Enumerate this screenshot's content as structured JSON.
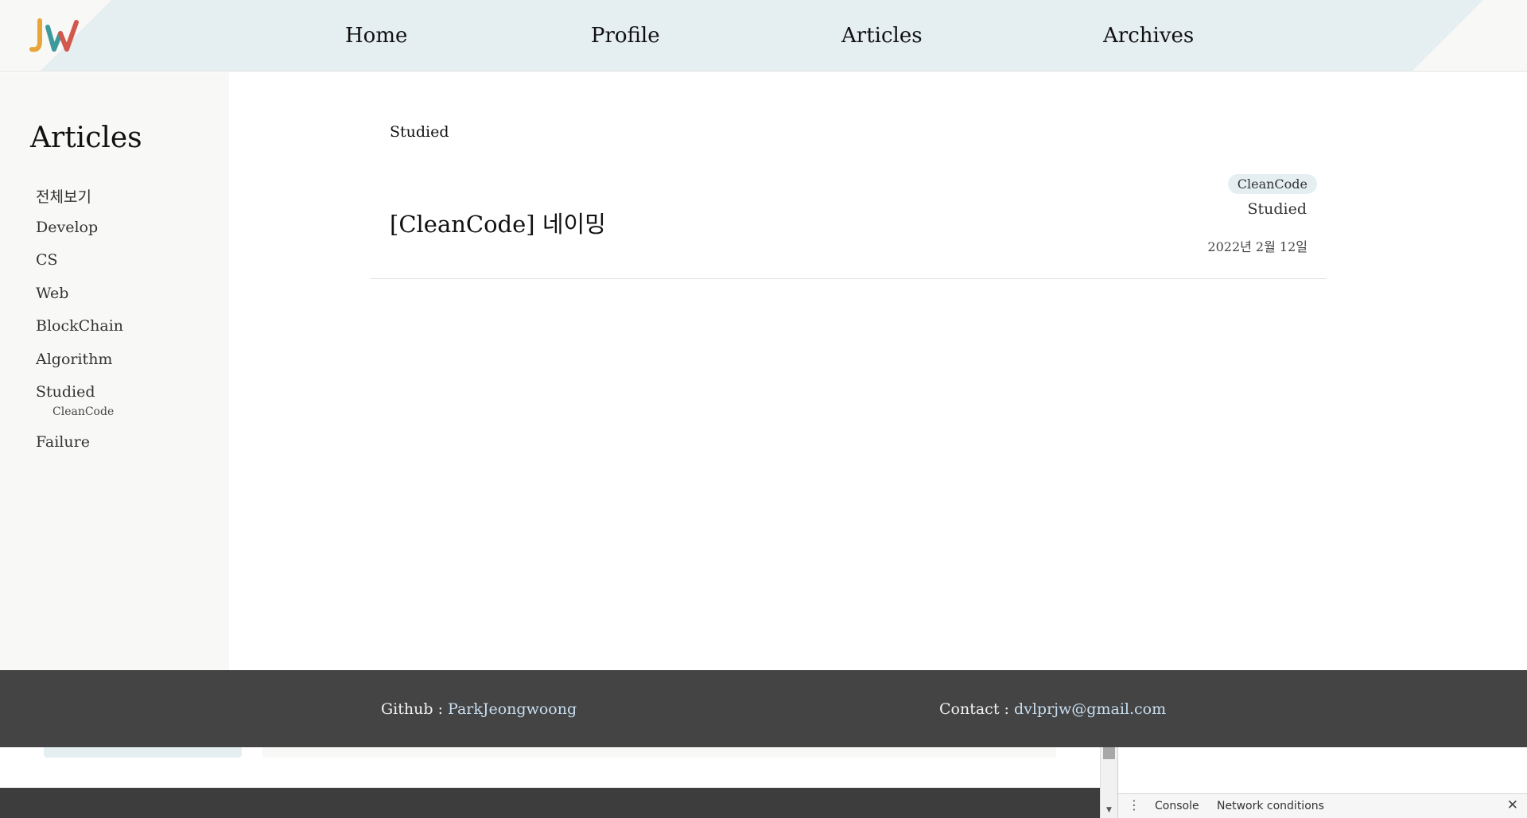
{
  "header": {
    "logo_text": "JW",
    "nav": [
      "Home",
      "Profile",
      "Articles",
      "Archives"
    ]
  },
  "sidebar": {
    "title": "Articles",
    "items": [
      "전체보기",
      "Develop",
      "CS",
      "Web",
      "BlockChain",
      "Algorithm",
      "Studied",
      "Failure"
    ],
    "subitems": [
      "CleanCode"
    ]
  },
  "main": {
    "category_heading": "Studied",
    "posts": [
      {
        "title": "[CleanCode] 네이밍",
        "tag": "CleanCode",
        "category": "Studied",
        "date": "2022년 2월 12일"
      }
    ]
  },
  "footer": {
    "github_label": "Github : ",
    "github_name": "ParkJeongwoong",
    "contact_label": "Contact : ",
    "contact_email": "dvlprjw@gmail.com"
  },
  "devtools": {
    "tabs": [
      "Console",
      "Network conditions"
    ],
    "close_glyph": "✕",
    "menu_glyph": "⋮"
  },
  "colors": {
    "header_band": "#e5eef1",
    "sidebar_bg": "#f8f8f6",
    "footer_bg": "#444444",
    "link": "#c8def0"
  }
}
